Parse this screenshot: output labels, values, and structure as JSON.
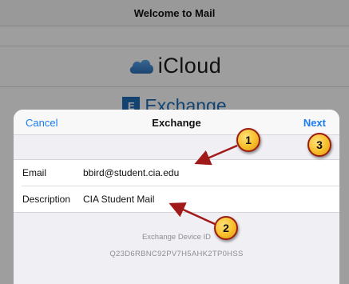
{
  "background": {
    "title": "Welcome to Mail",
    "providers": [
      {
        "name": "iCloud",
        "icon": "cloud-icon"
      },
      {
        "name": "Exchange",
        "icon": "exchange-logo-icon"
      }
    ]
  },
  "sheet": {
    "cancel_label": "Cancel",
    "title": "Exchange",
    "next_label": "Next",
    "fields": [
      {
        "label": "Email",
        "value": "bbird@student.cia.edu"
      },
      {
        "label": "Description",
        "value": "CIA Student Mail"
      }
    ],
    "device_id_label": "Exchange Device ID",
    "device_id": "Q23D6RBNC92PV7H5AHK2TP0HSS"
  },
  "callouts": {
    "badge_1": "1",
    "badge_2": "2",
    "badge_3": "3"
  },
  "colors": {
    "accent": "#1a7cf0",
    "badge_fill": "#f7be2b",
    "badge_border": "#9b1d12",
    "arrow": "#a11a1a",
    "exchange_brand": "#1f6fb6"
  }
}
